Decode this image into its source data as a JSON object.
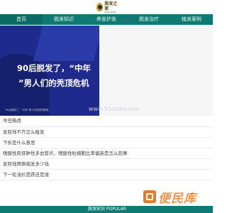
{
  "header": {
    "logo_text": "脱发之家",
    "logo_subtext": "tuofa zhijia",
    "brand_color": "#c9a227"
  },
  "nav": {
    "color": "#0e7a73",
    "items": [
      {
        "label": "首页"
      },
      {
        "label": "脱发知识"
      },
      {
        "label": "养发护发"
      },
      {
        "label": "脱发治疗"
      },
      {
        "label": "植发案例"
      }
    ]
  },
  "banner": {
    "title_line1": "90后脱发了，“中年",
    "title_line2": "”男人们的秃顶危机",
    "caption": "90后脱发了，“中年”男人们的秃顶危机",
    "watermark_url": "www.51ddwy.com",
    "color": "#1e2b8c"
  },
  "list": {
    "section_title": "今日热点",
    "items": [
      "发际线不齐怎么植发",
      "下折是什么意思",
      "嗜酸性肉芽肿性多血管炎、嗜酸性粒细胞比率偏高是怎么回事",
      "发际线两侧缩发多少钱",
      "下一轮油价是跌还是涨"
    ]
  },
  "watermark": {
    "text": "便民库",
    "color": "#f2934a"
  },
  "footer": {
    "label": "脱发知识 POPULAR"
  }
}
